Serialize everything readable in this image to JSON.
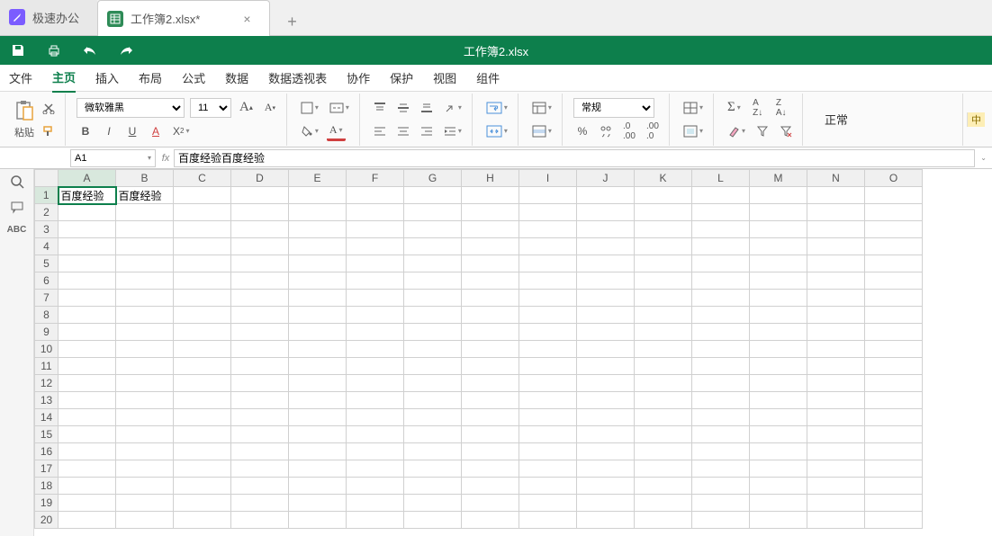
{
  "tabs": {
    "home": "极速办公",
    "file": "工作簿2.xlsx*"
  },
  "title": "工作簿2.xlsx",
  "menu": [
    "文件",
    "主页",
    "插入",
    "布局",
    "公式",
    "数据",
    "数据透视表",
    "协作",
    "保护",
    "视图",
    "组件"
  ],
  "menu_active": 1,
  "ribbon": {
    "paste": "粘贴",
    "font_name": "微软雅黑",
    "font_size": "11",
    "number_format": "常规",
    "status_label": "正常",
    "side_label": "中"
  },
  "cell_ref": "A1",
  "formula": "百度经验百度经验",
  "columns": [
    "A",
    "B",
    "C",
    "D",
    "E",
    "F",
    "G",
    "H",
    "I",
    "J",
    "K",
    "L",
    "M",
    "N",
    "O"
  ],
  "rows": 20,
  "cells": {
    "A1": "百度经验",
    "B1": "百度经验"
  },
  "active_cell": "A1"
}
